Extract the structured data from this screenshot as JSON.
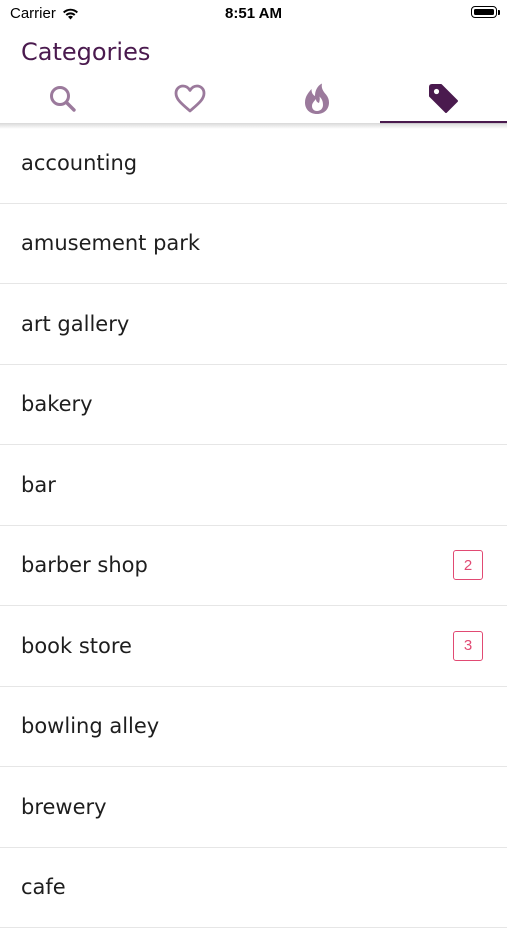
{
  "status_bar": {
    "carrier": "Carrier",
    "time": "8:51 AM"
  },
  "header": {
    "title": "Categories"
  },
  "tabs": [
    {
      "icon": "search-icon",
      "active": false
    },
    {
      "icon": "heart-icon",
      "active": false
    },
    {
      "icon": "flame-icon",
      "active": false
    },
    {
      "icon": "tag-icon",
      "active": true
    }
  ],
  "colors": {
    "accent": "#4a1a4e",
    "inactive_icon": "#9b7a9c",
    "badge": "#e14a73"
  },
  "categories": [
    {
      "label": "accounting",
      "badge": null
    },
    {
      "label": "amusement park",
      "badge": null
    },
    {
      "label": "art gallery",
      "badge": null
    },
    {
      "label": "bakery",
      "badge": null
    },
    {
      "label": "bar",
      "badge": null
    },
    {
      "label": "barber shop",
      "badge": "2"
    },
    {
      "label": "book store",
      "badge": "3"
    },
    {
      "label": "bowling alley",
      "badge": null
    },
    {
      "label": "brewery",
      "badge": null
    },
    {
      "label": "cafe",
      "badge": null
    }
  ]
}
